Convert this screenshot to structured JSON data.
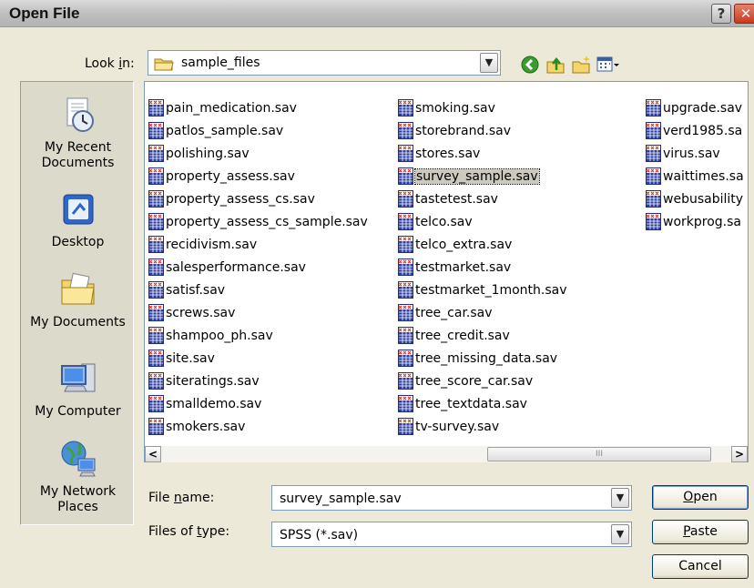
{
  "window": {
    "title": "Open File",
    "help_glyph": "?",
    "close_glyph": "✕"
  },
  "lookin": {
    "label_prefix": "Look ",
    "label_accel": "i",
    "label_suffix": "n:",
    "value": "sample_files"
  },
  "places": [
    {
      "label": "My Recent Documents",
      "icon": "recent-documents-icon"
    },
    {
      "label": "Desktop",
      "icon": "desktop-icon"
    },
    {
      "label": "My Documents",
      "icon": "my-documents-icon"
    },
    {
      "label": "My Computer",
      "icon": "my-computer-icon"
    },
    {
      "label": "My Network Places",
      "icon": "network-places-icon"
    }
  ],
  "files": {
    "column1": [
      "pain_medication.sav",
      "patlos_sample.sav",
      "polishing.sav",
      "property_assess.sav",
      "property_assess_cs.sav",
      "property_assess_cs_sample.sav",
      "recidivism.sav",
      "salesperformance.sav",
      "satisf.sav",
      "screws.sav",
      "shampoo_ph.sav",
      "site.sav",
      "siteratings.sav",
      "smalldemo.sav",
      "smokers.sav"
    ],
    "column2": [
      "smoking.sav",
      "storebrand.sav",
      "stores.sav",
      "survey_sample.sav",
      "tastetest.sav",
      "telco.sav",
      "telco_extra.sav",
      "testmarket.sav",
      "testmarket_1month.sav",
      "tree_car.sav",
      "tree_credit.sav",
      "tree_missing_data.sav",
      "tree_score_car.sav",
      "tree_textdata.sav",
      "tv-survey.sav"
    ],
    "column3": [
      "upgrade.sav",
      "verd1985.sa",
      "virus.sav",
      "waittimes.sa",
      "webusability",
      "workprog.sa"
    ],
    "selected": "survey_sample.sav"
  },
  "scrollbar": {
    "left_arrow": "<",
    "right_arrow": ">",
    "grip": "III"
  },
  "filename": {
    "label_prefix": "File ",
    "label_accel": "n",
    "label_suffix": "ame:",
    "value": "survey_sample.sav"
  },
  "filetype": {
    "label_prefix": "Files of ",
    "label_accel": "t",
    "label_suffix": "ype:",
    "value": "SPSS (*.sav)"
  },
  "buttons": {
    "open_accel": "O",
    "open_rest": "pen",
    "paste_accel": "P",
    "paste_rest": "aste",
    "cancel": "Cancel"
  },
  "colors": {
    "selection": "#ccc9bf",
    "dialog_bg": "#ece9d8",
    "field_border": "#7f9db9"
  }
}
